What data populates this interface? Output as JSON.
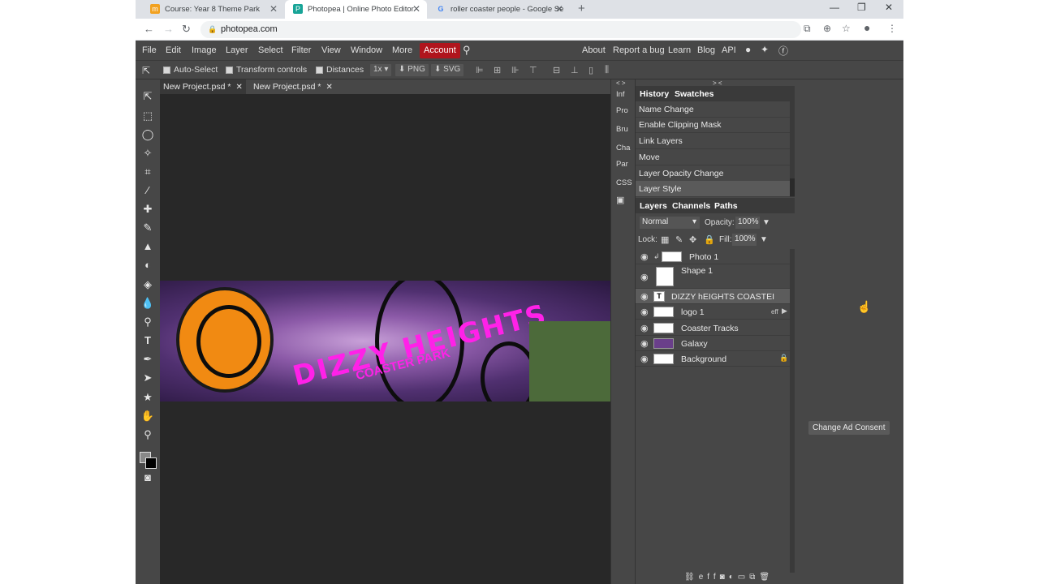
{
  "browser": {
    "tabs": [
      {
        "title": "Course: Year 8 Theme Park"
      },
      {
        "title": "Photopea | Online Photo Editor"
      },
      {
        "title": "roller coaster people - Google Se"
      }
    ],
    "url": "photopea.com"
  },
  "menubar": {
    "items": [
      "File",
      "Edit",
      "Image",
      "Layer",
      "Select",
      "Filter",
      "View",
      "Window",
      "More"
    ],
    "account": "Account",
    "right_links": [
      "About",
      "Report a bug",
      "Learn",
      "Blog",
      "API"
    ]
  },
  "options": {
    "auto_select": "Auto-Select",
    "transform_controls": "Transform controls",
    "distances": "Distances",
    "zoom": "1x",
    "png": "PNG",
    "svg": "SVG"
  },
  "document_tabs": [
    {
      "title": "New Project.psd *"
    },
    {
      "title": "New Project.psd *"
    }
  ],
  "banner": {
    "title": "DIZZY HEIGHTS",
    "subtitle": "COASTER PARK"
  },
  "mini_panel": [
    "Inf",
    "Pro",
    "Bru",
    "Cha",
    "Par",
    "CSS"
  ],
  "history": {
    "tabs": [
      "History",
      "Swatches"
    ],
    "items": [
      "Name Change",
      "Enable Clipping Mask",
      "Link Layers",
      "Move",
      "Layer Opacity Change",
      "Layer Style"
    ]
  },
  "layers": {
    "tabs": [
      "Layers",
      "Channels",
      "Paths"
    ],
    "blend_mode": "Normal",
    "opacity_label": "Opacity:",
    "opacity_value": "100%",
    "lock_label": "Lock:",
    "fill_label": "Fill:",
    "fill_value": "100%",
    "items": [
      {
        "name": "Photo 1"
      },
      {
        "name": "Shape 1"
      },
      {
        "name": "DIZZY hEIGHTS COASTEI"
      },
      {
        "name": "logo 1"
      },
      {
        "name": "Coaster Tracks"
      },
      {
        "name": "Galaxy"
      },
      {
        "name": "Background"
      }
    ],
    "eff_label": "eff"
  },
  "ad": {
    "consent_button": "Change Ad Consent"
  },
  "colors": {
    "accent_account": "#b0151d",
    "banner_text": "#ff21e8",
    "logo_orange": "#f18a12"
  }
}
